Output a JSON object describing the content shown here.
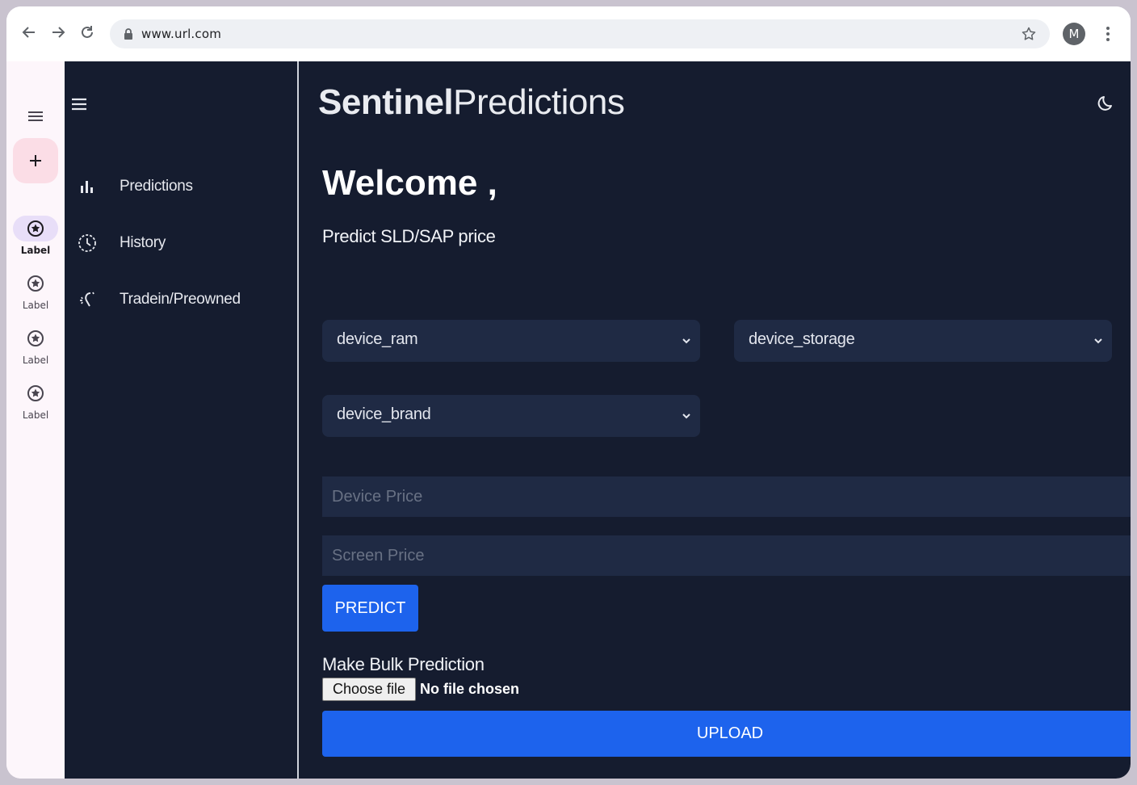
{
  "browser": {
    "url": "www.url.com",
    "profile_initial": "M"
  },
  "rail": {
    "items": [
      {
        "label": "Label",
        "active": true
      },
      {
        "label": "Label",
        "active": false
      },
      {
        "label": "Label",
        "active": false
      },
      {
        "label": "Label",
        "active": false
      }
    ]
  },
  "sidebar": {
    "items": [
      {
        "label": "Predictions",
        "icon": "bar-chart-icon"
      },
      {
        "label": "History",
        "icon": "history-icon"
      },
      {
        "label": "Tradein/Preowned",
        "icon": "magic-wand-icon"
      }
    ]
  },
  "header": {
    "brand_bold": "Sentinel",
    "brand_rest": "Predictions"
  },
  "main": {
    "welcome": "Welcome ,",
    "subtitle": "Predict SLD/SAP price",
    "selects": {
      "ram": "device_ram",
      "storage": "device_storage",
      "brand": "device_brand"
    },
    "device_price_placeholder": "Device Price",
    "screen_price_placeholder": "Screen Price",
    "predict_label": "PREDICT",
    "bulk_title": "Make Bulk Prediction",
    "choose_file_label": "Choose file",
    "file_status": "No file chosen",
    "upload_label": "UPLOAD"
  },
  "colors": {
    "app_bg": "#151c2f",
    "field_bg": "#1f2a44",
    "accent": "#1d63ed"
  }
}
